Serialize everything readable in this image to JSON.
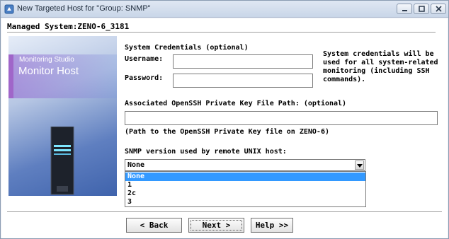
{
  "window": {
    "title": "New Targeted Host for \"Group: SNMP\"",
    "icons": {
      "app": "app-icon",
      "minimize": "minimize-icon",
      "maximize": "maximize-icon",
      "close": "close-icon"
    }
  },
  "header": {
    "managed_system": "Managed System:ZENO-6_3181"
  },
  "banner": {
    "product": "Monitoring Studio",
    "heading": "Monitor Host",
    "image": "server-tower-icon"
  },
  "credentials": {
    "section_title": "System Credentials (optional)",
    "username_label": "Username:",
    "username_value": "",
    "password_label": "Password:",
    "password_value": "",
    "note": "System credentials will be used for all system-related monitoring (including SSH commands)."
  },
  "ssh": {
    "key_label": "Associated OpenSSH Private Key File Path: (optional)",
    "key_value": "",
    "hint": "(Path to the OpenSSH Private Key file on ZENO-6)"
  },
  "snmp": {
    "label": "SNMP version used by remote UNIX host:",
    "selected": "None",
    "options": [
      "None",
      "1",
      "2c",
      "3"
    ],
    "highlighted_index": 0
  },
  "buttons": {
    "back": "< Back",
    "next": "Next >",
    "help": "Help >>"
  },
  "colors": {
    "selection": "#3399ff",
    "title_bar": "#dfe7f3",
    "banner": "#5f7fc0"
  }
}
